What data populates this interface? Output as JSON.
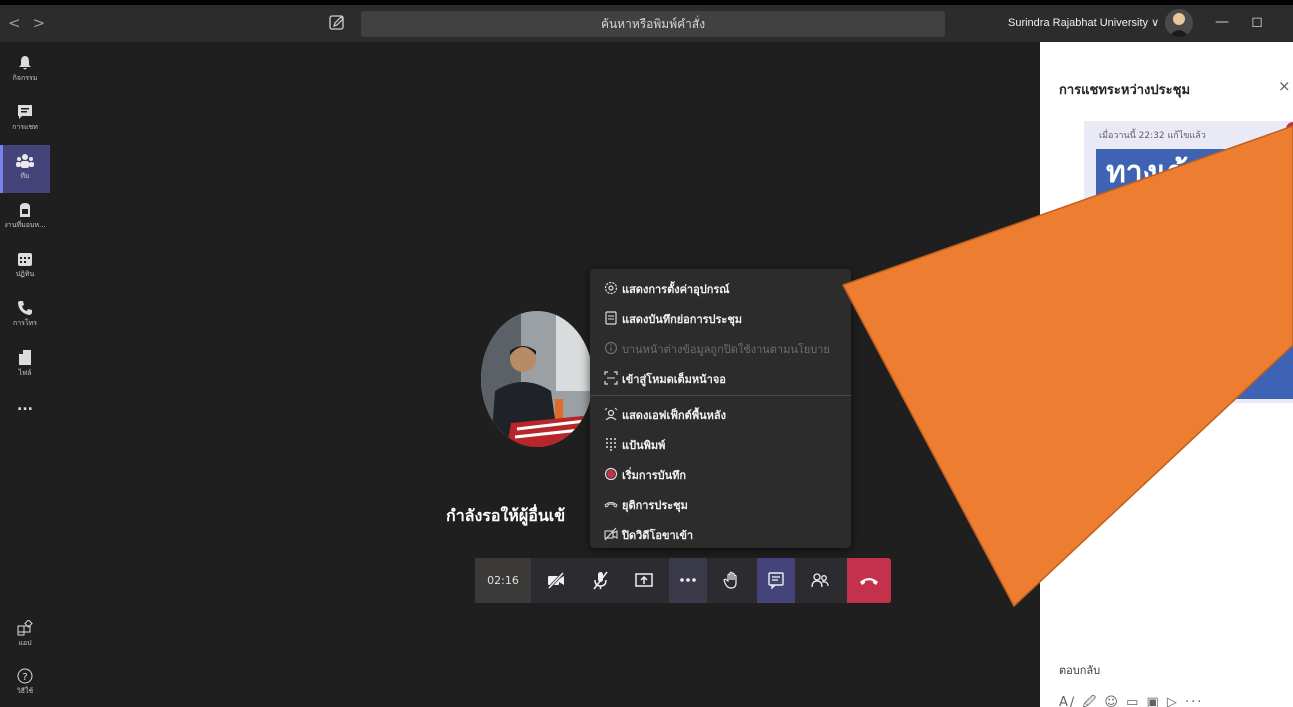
{
  "titlebar": {
    "back": "<",
    "forward": ">",
    "search_placeholder": "ค้นหาหรือพิมพ์คำสั่ง",
    "org": "Surindra Rajabhat University ∨",
    "minimize": "—",
    "maximize": "◻"
  },
  "rail": {
    "items": [
      {
        "label": "กิจกรรม",
        "icon": "bell-icon"
      },
      {
        "label": "การแชท",
        "icon": "chat-icon"
      },
      {
        "label": "ทีม",
        "icon": "teams-icon"
      },
      {
        "label": "งานที่มอบห...",
        "icon": "assignments-icon"
      },
      {
        "label": "ปฏิทิน",
        "icon": "calendar-icon"
      },
      {
        "label": "การโทร",
        "icon": "phone-icon"
      },
      {
        "label": "ไฟล์",
        "icon": "file-icon"
      },
      {
        "label": "...",
        "icon": "more-icon"
      }
    ],
    "apps_label": "แอป",
    "help_label": "วิธีใช้"
  },
  "stage": {
    "waiting_text": "กำลังรอให้ผู้อื่นเข้"
  },
  "controls": {
    "timer": "02:16",
    "buttons": [
      "camera-off-icon",
      "mic-off-icon",
      "share-screen-icon",
      "more-actions-icon",
      "raise-hand-icon",
      "chat-icon",
      "participants-icon",
      "hang-up-icon"
    ]
  },
  "menu": {
    "items": [
      {
        "label": "แสดงการตั้งค่าอุปกรณ์",
        "icon": "settings-icon",
        "enabled": true
      },
      {
        "label": "แสดงบันทึกย่อการประชุม",
        "icon": "notes-icon",
        "enabled": true
      },
      {
        "label": "บานหน้าต่างข้อมูลถูกปิดใช้งานตามนโยบาย",
        "icon": "info-icon",
        "enabled": false
      },
      {
        "label": "เข้าสู่โหมดเต็มหน้าจอ",
        "icon": "fullscreen-icon",
        "enabled": true
      },
      {
        "label": "แสดงเอฟเฟ็กต์พื้นหลัง",
        "icon": "background-effects-icon",
        "enabled": true
      },
      {
        "label": "แป้นพิมพ์",
        "icon": "keypad-icon",
        "enabled": true
      },
      {
        "label": "เริ่มการบันทึก",
        "icon": "record-icon",
        "enabled": true
      },
      {
        "label": "ยุติการประชุม",
        "icon": "end-meeting-icon",
        "enabled": true
      },
      {
        "label": "ปิดวิดีโอขาเข้า",
        "icon": "incoming-video-off-icon",
        "enabled": true
      }
    ]
  },
  "chat": {
    "title": "การแชทระหว่างประชุม",
    "close": "×",
    "message_meta": "เมื่อวานนี้ 22:32   แก้ไขแล้ว",
    "image_text": "ทางเข้",
    "image_more": "..",
    "reply_placeholder": "ตอบกลับ",
    "compose_icons": "A∕ 🖉 ☺ ▭ ▣ ▷ ···"
  },
  "colors": {
    "accent": "#7b83eb",
    "hangup": "#c4314b",
    "overlay_triangle": "#ed7d31",
    "record": "#c4314b"
  }
}
